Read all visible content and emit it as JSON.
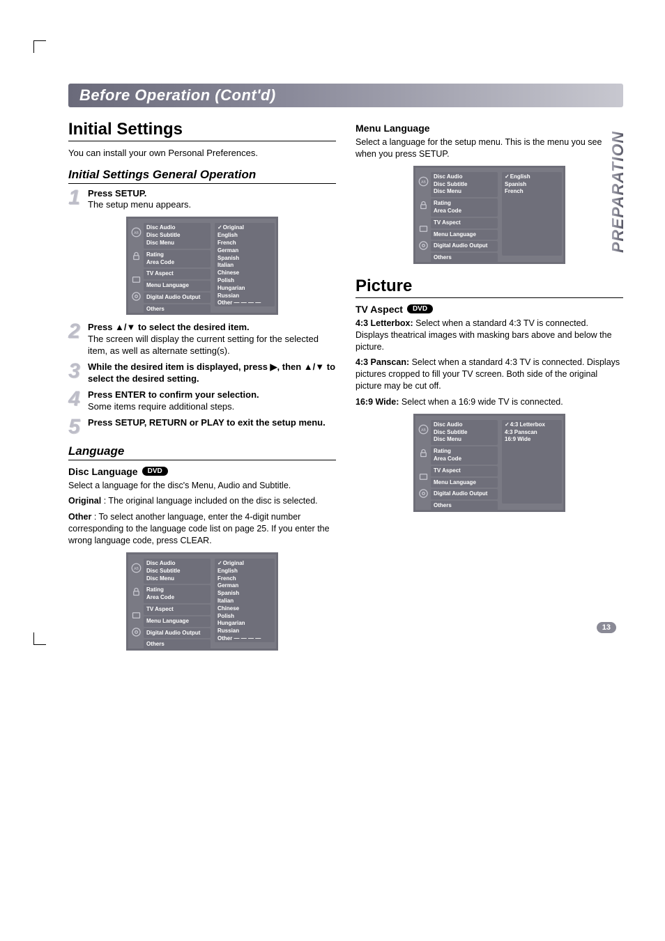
{
  "header": "Before Operation (Cont'd)",
  "sideLabel": "PREPARATION",
  "pageNumber": "13",
  "left": {
    "h1": "Initial Settings",
    "intro": "You can install your own Personal Preferences.",
    "h2general": "Initial Settings General Operation",
    "steps": {
      "s1": {
        "num": "1",
        "bold": "Press SETUP.",
        "text": "The setup menu appears."
      },
      "s2": {
        "num": "2",
        "bold": "Press ▲/▼ to select the desired item.",
        "text": "The screen will display the current setting for the selected item, as well as alternate setting(s)."
      },
      "s3": {
        "num": "3",
        "bold": "While the desired item is displayed, press ▶, then ▲/▼ to select the desired setting."
      },
      "s4": {
        "num": "4",
        "bold": "Press ENTER to confirm your selection.",
        "text": "Some items require additional steps."
      },
      "s5": {
        "num": "5",
        "bold": "Press SETUP, RETURN or PLAY to exit the setup menu."
      }
    },
    "langH2": "Language",
    "discLangH3": "Disc Language",
    "discLangBadge": "DVD",
    "discLangP1": "Select a language for the disc's Menu, Audio and Subtitle.",
    "discLangOriginalLabel": "Original",
    "discLangOriginalText": " : The original language included on the disc is selected.",
    "discLangOtherLabel": "Other",
    "discLangOtherText": " : To select another language, enter the 4-digit number corresponding to the language code list on page 25. If you enter the wrong language code, press CLEAR."
  },
  "right": {
    "menuLangH3": "Menu Language",
    "menuLangP": "Select a language for the setup menu. This is the menu you see when you press SETUP.",
    "pictureH1": "Picture",
    "tvAspectH3": "TV Aspect",
    "tvAspectBadge": "DVD",
    "tv43lbLabel": "4:3 Letterbox:",
    "tv43lbText": " Select when a standard 4:3 TV is connected. Displays theatrical images with masking bars above and below the picture.",
    "tv43psLabel": "4:3 Panscan:",
    "tv43psText": " Select when a standard 4:3 TV is connected. Displays pictures cropped to fill your TV screen. Both side of the original picture may be cut off.",
    "tv169Label": "16:9 Wide:",
    "tv169Text": " Select when a 16:9 wide TV is connected."
  },
  "menu": {
    "leftItems": {
      "g1a": "Disc Audio",
      "g1b": "Disc Subtitle",
      "g1c": "Disc Menu",
      "g2a": "Rating",
      "g2b": "Area Code",
      "g3a": "TV Aspect",
      "g4a": "Menu Language",
      "g5a": "Digital Audio Output",
      "g6a": "Others"
    },
    "langOptions": {
      "o1": "Original",
      "o2": "English",
      "o3": "French",
      "o4": "German",
      "o5": "Spanish",
      "o6": "Italian",
      "o7": "Chinese",
      "o8": "Polish",
      "o9": "Hungarian",
      "o10": "Russian",
      "o11": "Other  — — — —"
    },
    "menuLangOptions": {
      "o1": "English",
      "o2": "Spanish",
      "o3": "French"
    },
    "tvOptions": {
      "o1": "4:3 Letterbox",
      "o2": "4:3 Panscan",
      "o3": "16:9 Wide"
    }
  }
}
